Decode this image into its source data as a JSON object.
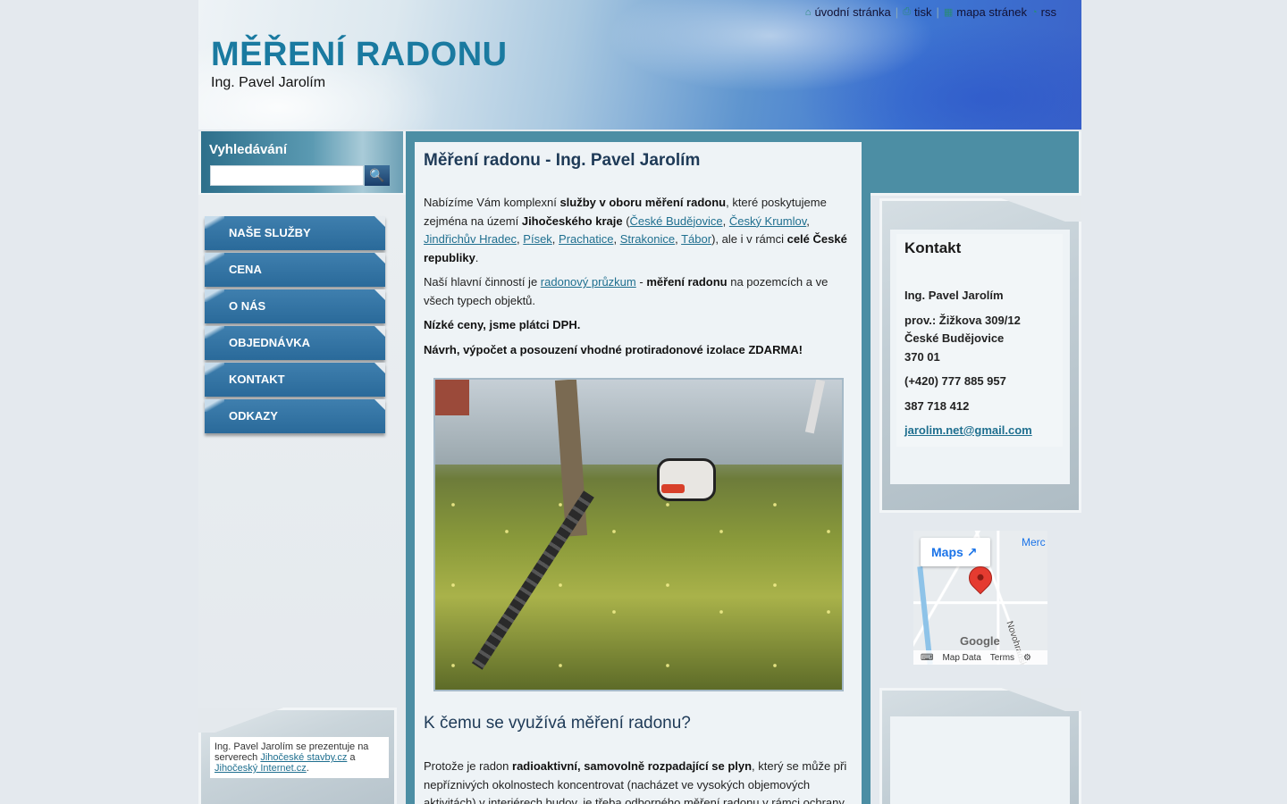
{
  "header": {
    "title": "MĚŘENÍ RADONU",
    "subtitle": "Ing. Pavel Jarolím",
    "topnav": [
      {
        "label": "úvodní stránka",
        "icon": "home-icon"
      },
      {
        "label": "tisk",
        "icon": "print-icon"
      },
      {
        "label": "mapa stránek",
        "icon": "sitemap-icon"
      },
      {
        "label": "rss",
        "icon": "rss-icon"
      }
    ],
    "separator": "|"
  },
  "search": {
    "label": "Vyhledávání",
    "value": "",
    "button_icon": "magnifier-icon",
    "button_glyph": "🔍"
  },
  "menu": [
    {
      "label": "NAŠE SLUŽBY"
    },
    {
      "label": "CENA"
    },
    {
      "label": "O NÁS"
    },
    {
      "label": "OBJEDNÁVKA"
    },
    {
      "label": "KONTAKT"
    },
    {
      "label": "ODKAZY"
    }
  ],
  "footer_note": {
    "pre": "Ing. Pavel Jarolím se prezentuje na serverech ",
    "link1": "Jihočeské stavby.cz",
    "mid": " a ",
    "link2": "Jihočeský Internet.cz",
    "post": "."
  },
  "content": {
    "heading": "Měření radonu - Ing. Pavel Jarolím",
    "p1": {
      "t1": "Nabízíme Vám komplexní ",
      "b1": "služby v oboru měření radonu",
      "t2": ", které poskytujeme zejména na území ",
      "b2": "Jihočeského kraje",
      "t3": " (",
      "links": [
        "České Budějovice",
        "Český Krumlov",
        "Jindřichův Hradec",
        "Písek",
        "Prachatice",
        "Strakonice",
        "Tábor"
      ],
      "link_sep": ", ",
      "t4": "), ale i v rámci ",
      "b3": "celé České republiky",
      "t5": "."
    },
    "p2": {
      "t1": "Naší hlavní činností je ",
      "link": "radonový průzkum",
      "t2": " - ",
      "b1": "měření radonu",
      "t3": " na pozemcích a ve všech typech objektů."
    },
    "p3": "Nízké ceny, jsme plátci DPH.",
    "p4": "Návrh, výpočet a posouzení vhodné protiradonové izolace ZDARMA!",
    "heading2": "K čemu se využívá měření radonu?",
    "p5": {
      "t1": "Protože je radon ",
      "b1": "radioaktivní, samovolně rozpadající se plyn",
      "t2": ", který se může při nepříznivých okolnostech koncentrovat (nacházet ve vysokých objemových aktivitách) v interiérech budov, je třeba odborného měření radonu v rámci ochrany"
    }
  },
  "contact": {
    "title": "Kontakt",
    "name": "Ing. Pavel Jarolím",
    "address_line1": "prov.: Žižkova 309/12",
    "address_line2": "České Budějovice",
    "address_line3": "370 01",
    "phone1": "(+420) 777 885 957",
    "phone2": "387 718 412",
    "email": "jarolim.net@gmail.com"
  },
  "map": {
    "button": "Maps",
    "place": "Merc",
    "street": "Novohradská",
    "logo": "Google",
    "attrib_keyboard": "⌨",
    "attrib_data": "Map Data",
    "attrib_terms": "Terms",
    "attrib_gear": "⚙"
  },
  "colors": {
    "accent": "#1a7aa0",
    "menu": "#2a6a9a",
    "content_frame": "#4c8ea4",
    "link": "#1f6f8f"
  }
}
